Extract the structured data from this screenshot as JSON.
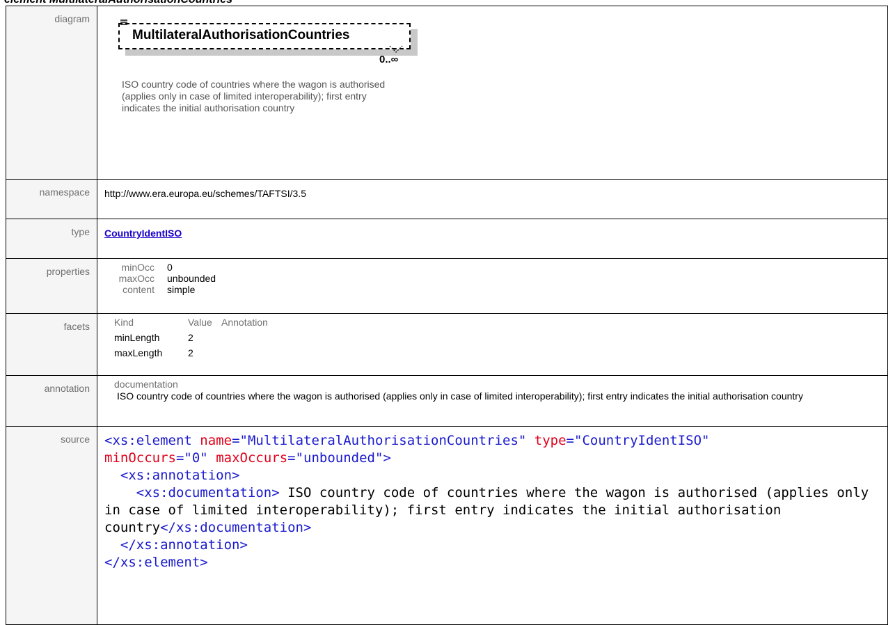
{
  "heading": "element MultilateralAuthorisationCountries",
  "labels": {
    "diagram": "diagram",
    "namespace": "namespace",
    "type": "type",
    "properties": "properties",
    "facets": "facets",
    "annotation": "annotation",
    "source": "source"
  },
  "diagram": {
    "element_name": "MultilateralAuthorisationCountries",
    "occurs": "0..∞",
    "note": "ISO country code of countries where the wagon is authorised (applies only in case of limited interoperability); first entry indicates the initial authorisation country"
  },
  "namespace": "http://www.era.europa.eu/schemes/TAFTSI/3.5",
  "type": "CountryIdentISO",
  "properties": [
    {
      "key": "minOcc",
      "value": "0"
    },
    {
      "key": "maxOcc",
      "value": "unbounded"
    },
    {
      "key": "content",
      "value": "simple"
    }
  ],
  "facets": {
    "headers": [
      "Kind",
      "Value",
      "Annotation"
    ],
    "rows": [
      {
        "kind": "minLength",
        "value": "2"
      },
      {
        "kind": "maxLength",
        "value": "2"
      }
    ]
  },
  "annotation": {
    "label": "documentation",
    "text": "ISO country code of countries where the wagon is authorised (applies only in case of limited interoperability); first entry indicates the initial authorisation country"
  },
  "source": {
    "tag_open": "<xs:element",
    "attr_name": "name",
    "attr_name_val": "\"MultilateralAuthorisationCountries\"",
    "attr_type": "type",
    "attr_type_val": "\"CountryIdentISO\"",
    "attr_min": "minOccurs",
    "attr_min_val": "\"0\"",
    "attr_max": "maxOccurs",
    "attr_max_val": "\"unbounded\"",
    "tag_close_bracket": ">",
    "annotation_open": "<xs:annotation>",
    "documentation_open": "<xs:documentation>",
    "documentation_text": " ISO country code of countries where the wagon is authorised (applies only in case of limited interoperability); first entry indicates the initial authorisation country",
    "documentation_close": "</xs:documentation>",
    "annotation_close": "</xs:annotation>",
    "element_close": "</xs:element>"
  }
}
